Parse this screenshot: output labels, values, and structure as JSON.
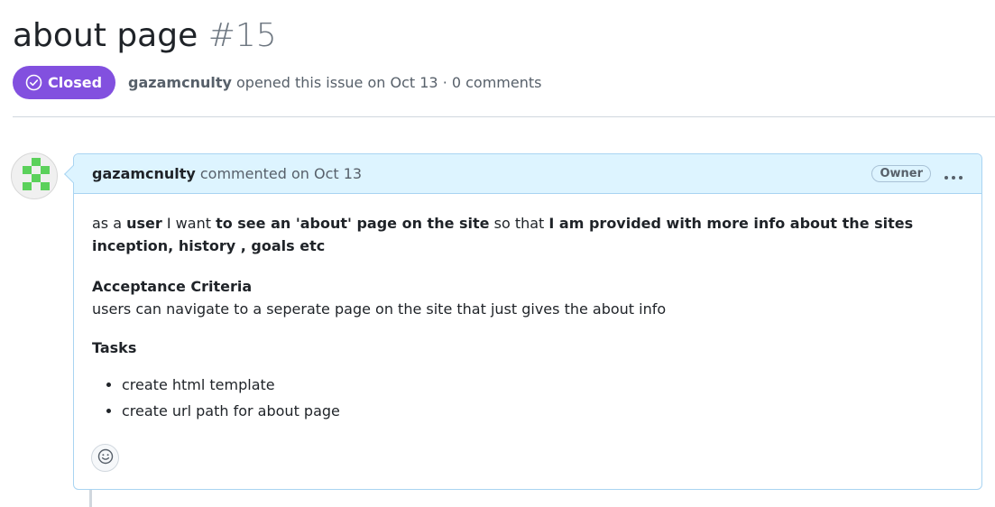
{
  "issue": {
    "title": "about page",
    "number": "#15",
    "state": "Closed",
    "author": "gazamcnulty",
    "meta_text": " opened this issue on Oct 13 · 0 comments"
  },
  "comment": {
    "author": "gazamcnulty",
    "action_text": "commented on Oct 13",
    "role_badge": "Owner",
    "body": {
      "story": {
        "p1": "as a ",
        "user": "user",
        "p2": " I want ",
        "want": "to see an 'about' page on the site",
        "p3": " so that ",
        "benefit": "I am provided with more info about the sites inception, history , goals etc"
      },
      "criteria_heading": "Acceptance Criteria",
      "criteria_text": "users can navigate to a seperate page on the site that just gives the about info",
      "tasks_heading": "Tasks",
      "tasks": [
        "create html template",
        "create url path for about page"
      ]
    }
  },
  "icons": {
    "state": "check-circle-icon",
    "menu": "kebab-horizontal-icon",
    "reaction": "smiley-icon"
  },
  "colors": {
    "closed_badge": "#8250df",
    "comment_header_bg": "#ddf4ff",
    "comment_border": "#a9d4f2",
    "avatar_green": "#5bd15b"
  }
}
